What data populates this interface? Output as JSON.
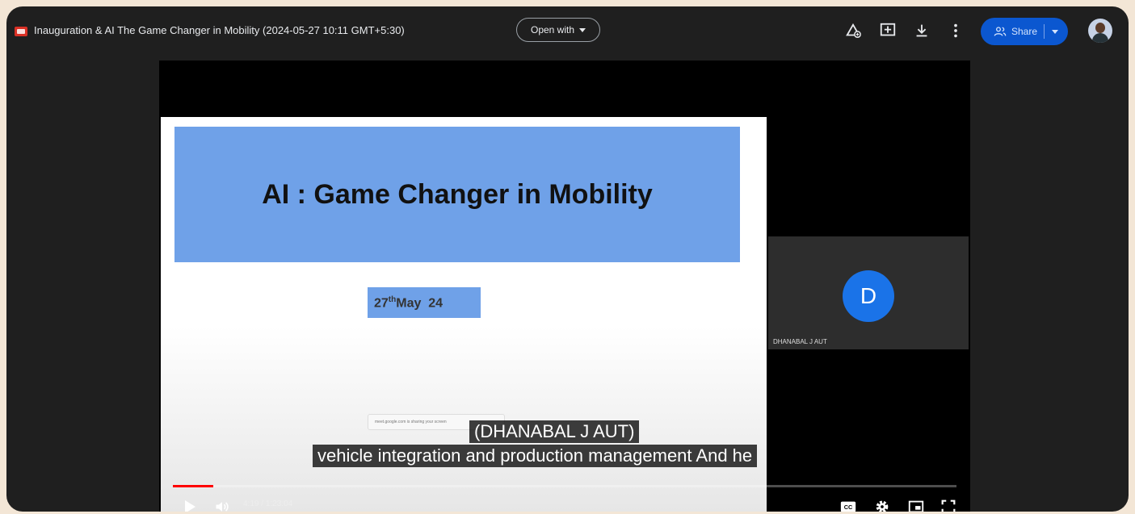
{
  "header": {
    "title": "Inauguration & AI The Game Changer in Mobility (2024-05-27 10:11 GMT+5:30)",
    "open_with_label": "Open with",
    "share_label": "Share",
    "icons": [
      "add-shortcut-icon",
      "add-comment-icon",
      "download-icon",
      "more-vert-icon"
    ]
  },
  "slide": {
    "title": "AI : Game Changer in Mobility",
    "date_day": "27",
    "date_suffix": "th",
    "date_rest": "May  24",
    "share_notice": "meet.google.com is sharing your screen"
  },
  "participant": {
    "initial": "D",
    "name": "DHANABAL J AUT",
    "avatar_color": "#1a73e8"
  },
  "captions": {
    "speaker": "(DHANABAL J AUT)",
    "text": "vehicle integration and production management And he"
  },
  "player": {
    "current_time": "4:19",
    "separator": " / ",
    "duration": "1:23:04",
    "progress_fraction": 0.052,
    "accent": "#ff0000"
  }
}
